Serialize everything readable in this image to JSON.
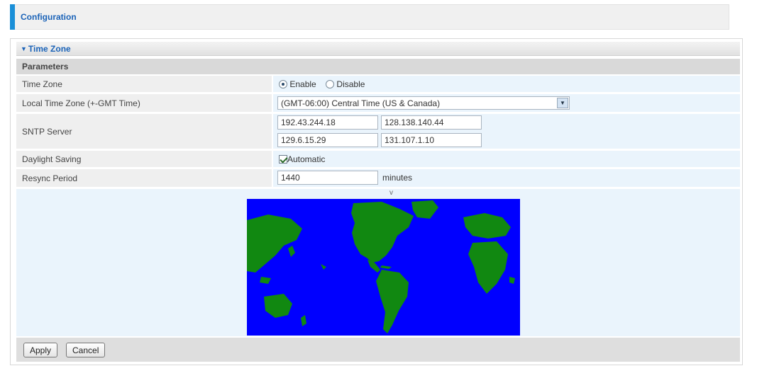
{
  "header": {
    "title": "Configuration"
  },
  "section": {
    "title": "Time Zone"
  },
  "parameters": {
    "title": "Parameters"
  },
  "rows": {
    "time_zone": {
      "label": "Time Zone",
      "options": [
        "Enable",
        "Disable"
      ],
      "selected": "Enable"
    },
    "local_tz": {
      "label": "Local Time Zone (+-GMT Time)",
      "value": "(GMT-06:00) Central Time (US & Canada)"
    },
    "sntp": {
      "label": "SNTP Server",
      "servers": [
        "192.43.244.18",
        "128.138.140.44",
        "129.6.15.29",
        "131.107.1.10"
      ]
    },
    "daylight": {
      "label": "Daylight Saving",
      "option": "Automatic",
      "checked": true
    },
    "resync": {
      "label": "Resync Period",
      "value": "1440",
      "unit": "minutes"
    }
  },
  "map": {
    "marker": "v",
    "ocean_color": "#0000ff",
    "land_color": "#118811"
  },
  "buttons": {
    "apply": "Apply",
    "cancel": "Cancel"
  },
  "colors": {
    "accent": "#1a8fd8",
    "link": "#1b63b8"
  }
}
